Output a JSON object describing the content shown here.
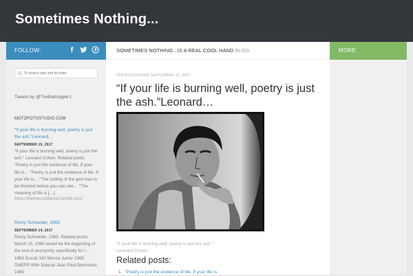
{
  "header": {
    "site_title": "Sometimes Nothing..."
  },
  "follow": {
    "label": "FOLLOW:",
    "icons": [
      "facebook-icon",
      "twitter-icon",
      "pinterest-icon"
    ]
  },
  "more": {
    "label": "MORE"
  },
  "search": {
    "placeholder": "To search type and hit enter"
  },
  "sidebar": {
    "tweets": "Tweets by @TheBarhopper1",
    "feed_heading": "MOTOFOTOSTUDIO.COM",
    "feed": [
      {
        "title": "“If your life is burning well, poetry is just the ash.”Leonard…",
        "date": "SEPTEMBER 15, 2017",
        "body": "“If your life is burning well, poetry is just the ash.” Leonard Cohen. Related posts: “Poetry is just the evidence of life. If your life is… “Poetry is just the evidence of life. If your life is… “The cutting of the gem has to be finished before you can see… “The meaning of life is […]",
        "link": "https://theimpossiblecool.tumblr.com/"
      },
      {
        "title": "Romy Schneider, 1965.",
        "date": "SEPTEMBER 14, 2017",
        "body": "Romy Schneider, 1965.  Related posts: March 15, 1965 would be the beginning of the end of anonymity specifically for t… 1965 Ducati 160 Monza Junior 1965 DNEPR With Sidecar Jean Paul Belmondo, 1965"
      }
    ]
  },
  "main": {
    "breadcrumb_main": "SOMETIMES NOTHING...IS A REAL COOL HAND",
    "breadcrumb_blog": "BLOG",
    "post_meta": "UNCATEGORIZED SEPTEMBER 15, 2017",
    "post_title": "“If your life is burning well, poetry is just the ash.”Leonard…",
    "caption_line1": "“If your life is burning well, poetry is just the ash.”",
    "caption_line2": "Leonard Cohen.",
    "related_heading": "Related posts:",
    "related_items": [
      {
        "num": "1.",
        "text": "“Poetry is just the evidence of life. If your life is"
      }
    ]
  },
  "colors": {
    "header_bg": "#33363b",
    "follow_bg": "#3b8dbd",
    "more_bg": "#82b965",
    "link": "#3b8dbd"
  }
}
